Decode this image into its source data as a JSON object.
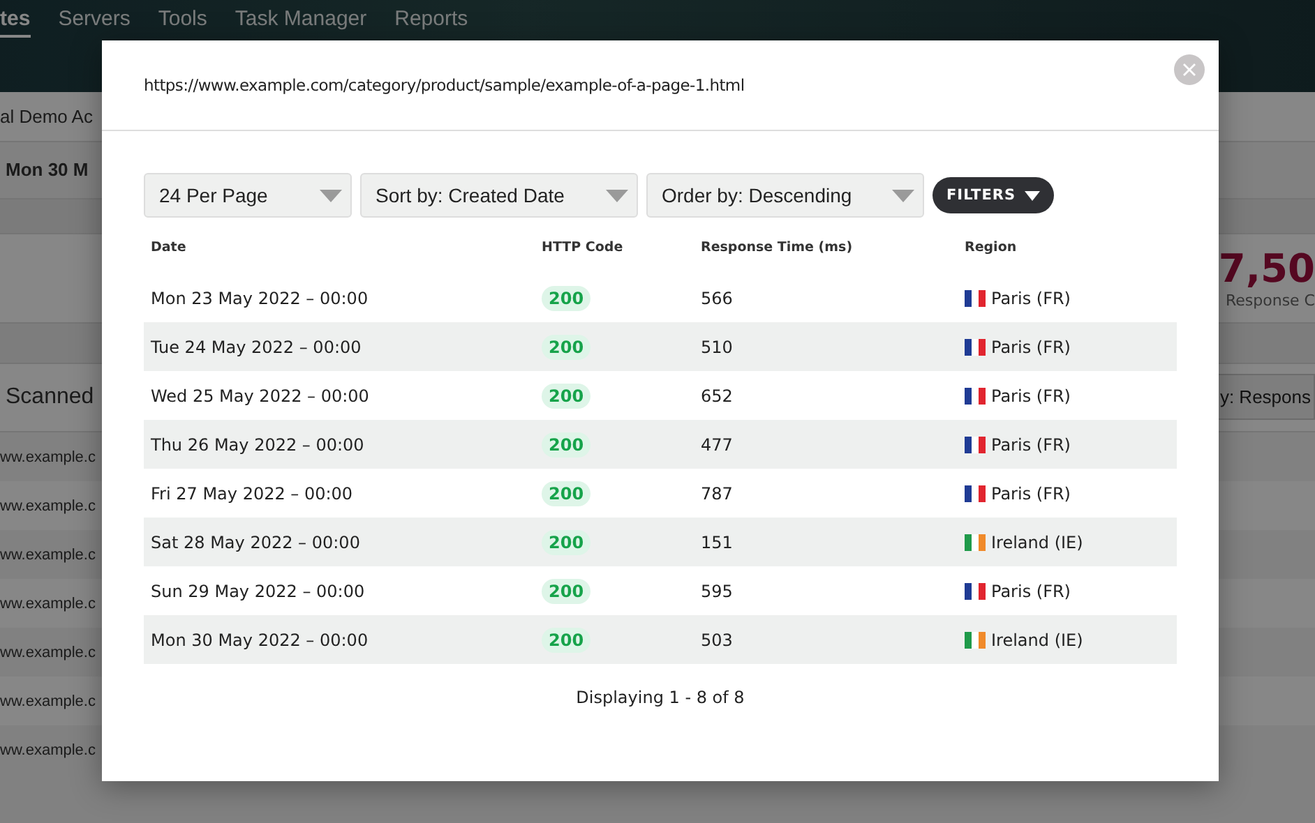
{
  "background_page": {
    "nav": [
      {
        "label": "tes",
        "selected": true
      },
      {
        "label": "Servers",
        "selected": false
      },
      {
        "label": "Tools",
        "selected": false
      },
      {
        "label": "Task Manager",
        "selected": false
      },
      {
        "label": "Reports",
        "selected": false
      }
    ],
    "account": "al Demo Ac",
    "date": "Mon 30 M",
    "stat_value": "7,50",
    "stat_label": "Response C",
    "section_title": "Scanned",
    "sort_select": "y: Respons",
    "rows": [
      "ww.example.c",
      "ww.example.c",
      "ww.example.c",
      "ww.example.c",
      "ww.example.c",
      "ww.example.c",
      "ww.example.c"
    ]
  },
  "modal": {
    "url": "https://www.example.com/category/product/sample/example-of-a-page-1.html",
    "selects": [
      "24 Per Page",
      "Sort by: Created Date",
      "Order by: Descending"
    ],
    "filters_button": "FILTERS",
    "table": {
      "columns": [
        "Date",
        "HTTP Code",
        "Response Time (ms)",
        "Region"
      ],
      "rows": [
        {
          "date": "Mon 23 May 2022 – 00:00",
          "code": "200",
          "time": "566",
          "region": "Paris (FR)",
          "kind": "fr"
        },
        {
          "date": "Tue 24 May 2022 – 00:00",
          "code": "200",
          "time": "510",
          "region": "Paris (FR)",
          "kind": "fr"
        },
        {
          "date": "Wed 25 May 2022 – 00:00",
          "code": "200",
          "time": "652",
          "region": "Paris (FR)",
          "kind": "fr"
        },
        {
          "date": "Thu 26 May 2022 – 00:00",
          "code": "200",
          "time": "477",
          "region": "Paris (FR)",
          "kind": "fr"
        },
        {
          "date": "Fri 27 May 2022 – 00:00",
          "code": "200",
          "time": "787",
          "region": "Paris (FR)",
          "kind": "fr"
        },
        {
          "date": "Sat 28 May 2022 – 00:00",
          "code": "200",
          "time": "151",
          "region": "Ireland (IE)",
          "kind": "ie"
        },
        {
          "date": "Sun 29 May 2022 – 00:00",
          "code": "200",
          "time": "595",
          "region": "Paris (FR)",
          "kind": "fr"
        },
        {
          "date": "Mon 30 May 2022 – 00:00",
          "code": "200",
          "time": "503",
          "region": "Ireland (IE)",
          "kind": "ie"
        }
      ]
    },
    "footer": "Displaying 1 - 8 of 8"
  }
}
